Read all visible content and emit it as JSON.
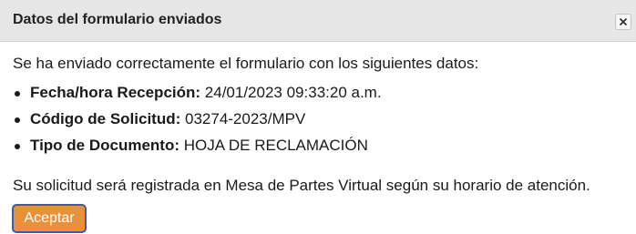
{
  "dialog": {
    "title": "Datos del formulario enviados",
    "close_icon": "close-icon",
    "intro": "Se ha enviado correctamente el formulario con los siguientes datos:",
    "fields": [
      {
        "label": "Fecha/hora Recepción:",
        "value": "24/01/2023 09:33:20 a.m."
      },
      {
        "label": "Código de Solicitud:",
        "value": "03274-2023/MPV"
      },
      {
        "label": "Tipo de Documento:",
        "value": "HOJA DE RECLAMACIÓN"
      }
    ],
    "outro": "Su solicitud será registrada en Mesa de Partes Virtual según su horario de atención.",
    "accept_label": "Aceptar"
  },
  "colors": {
    "titlebar_bg": "#e6e6e6",
    "button_bg": "#e8913a",
    "button_border": "#3d5ba8"
  }
}
